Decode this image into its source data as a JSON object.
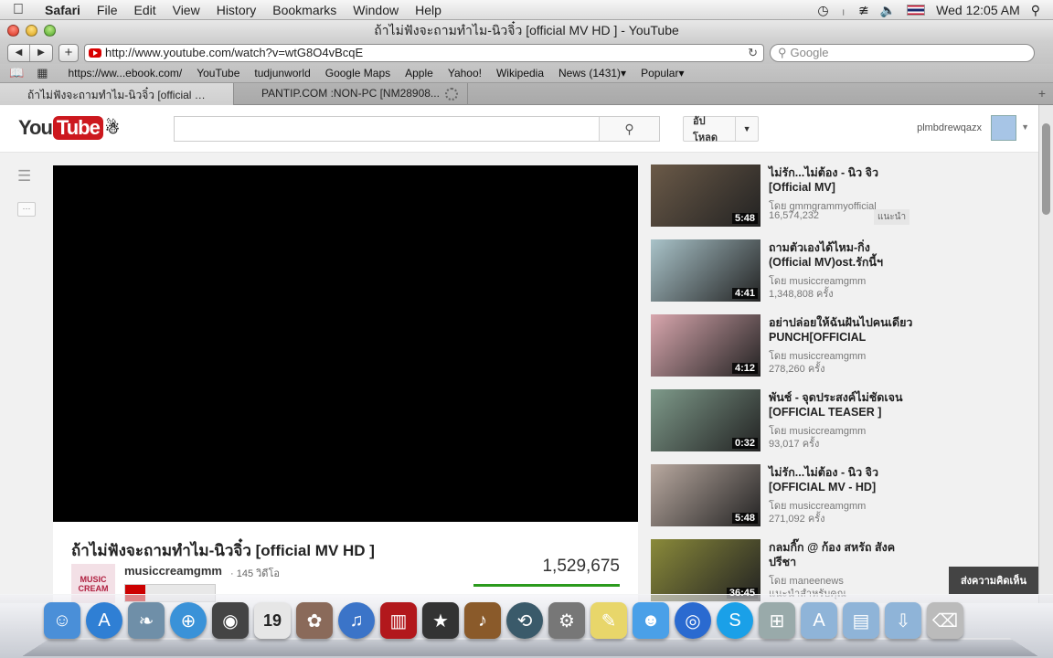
{
  "menubar": {
    "app": "Safari",
    "items": [
      "File",
      "Edit",
      "View",
      "History",
      "Bookmarks",
      "Window",
      "Help"
    ],
    "clock": "Wed 12:05 AM"
  },
  "window": {
    "title": "ถ้าไม่ฟังจะถามทำไม-นิวจิ๋ว [official MV HD ] - YouTube"
  },
  "toolbar": {
    "url": "http://www.youtube.com/watch?v=wtG8O4vBcqE",
    "search_placeholder": "Google"
  },
  "bookmarks": [
    "https://ww...ebook.com/",
    "YouTube",
    "tudjunworld",
    "Google Maps",
    "Apple",
    "Yahoo!",
    "Wikipedia",
    "News (1431)",
    "Popular"
  ],
  "tabs": [
    {
      "label": "ถ้าไม่ฟังจะถามทำไม-นิวจิ๋ว [official MV..."
    },
    {
      "label": "PANTIP.COM :NON-PC [NM28908..."
    }
  ],
  "youtube": {
    "logo_you": "You",
    "logo_tube": "Tube",
    "upload_label": "อัปโหลด",
    "username": "plmbdrewqazx",
    "video_title": "ถ้าไม่ฟังจะถามทำไม-นิวจิ๋ว [official MV HD ]",
    "channel_name": "musiccreamgmm",
    "channel_thumb": "MUSIC CREAM",
    "channel_video_count": "· 145 วิดีโอ",
    "view_count": "1,529,675",
    "feedback": "ส่งความคิดเห็น"
  },
  "related": [
    {
      "title": "ไม่รัก...ไม่ต้อง - นิว จิว [Official MV]",
      "by": "โดย gmmgrammyofficial",
      "views": "16,574,232",
      "duration": "5:48",
      "badge": "แนะนำ",
      "color": "#6b5a48"
    },
    {
      "title": "ถามตัวเองได้ไหม-กิ่ง (Official MV)ost.รักนี้ฯ",
      "by": "โดย musiccreamgmm",
      "views": "1,348,808 ครั้ง",
      "duration": "4:41",
      "badge": "",
      "color": "#a9c3c9"
    },
    {
      "title": "อย่าปล่อยให้ฉันฝันไปคนเดียว PUNCH[OFFICIAL",
      "by": "โดย musiccreamgmm",
      "views": "278,260 ครั้ง",
      "duration": "4:12",
      "badge": "",
      "color": "#d8a6ad"
    },
    {
      "title": "พันช์ - จุดประสงค์ไม่ชัดเจน [OFFICIAL TEASER ]",
      "by": "โดย musiccreamgmm",
      "views": "93,017 ครั้ง",
      "duration": "0:32",
      "badge": "",
      "color": "#7e9a8a"
    },
    {
      "title": "ไม่รัก...ไม่ต้อง - นิว จิว [OFFICIAL MV - HD]",
      "by": "โดย musiccreamgmm",
      "views": "271,092 ครั้ง",
      "duration": "5:48",
      "badge": "",
      "color": "#b9a9a0"
    },
    {
      "title": "กลมกิ๊ก @ ก้อง สหรัถ สังคปรีชา",
      "by": "โดย maneenews",
      "views": "แนะนำสำหรับคุณ",
      "duration": "36:45",
      "badge": "",
      "color": "#8a8a3a"
    }
  ],
  "dock": [
    {
      "icon": "finder-icon",
      "color": "#4a8fd8"
    },
    {
      "icon": "app-store-icon",
      "color": "#2f7fd4"
    },
    {
      "icon": "preview-icon",
      "color": "#6f8fa8"
    },
    {
      "icon": "safari-icon",
      "color": "#3a92d8"
    },
    {
      "icon": "facetime-icon",
      "color": "#444"
    },
    {
      "icon": "calendar-icon",
      "color": "#e6e6e6"
    },
    {
      "icon": "photo-booth-icon",
      "color": "#8a6a5a"
    },
    {
      "icon": "itunes-icon",
      "color": "#3b74c8"
    },
    {
      "icon": "photo-booth-red-icon",
      "color": "#b2181c"
    },
    {
      "icon": "imovie-icon",
      "color": "#333"
    },
    {
      "icon": "garageband-icon",
      "color": "#8a5a2a"
    },
    {
      "icon": "time-machine-icon",
      "color": "#3a5a6a"
    },
    {
      "icon": "system-preferences-icon",
      "color": "#777"
    },
    {
      "icon": "stickies-icon",
      "color": "#e8d66a"
    },
    {
      "icon": "messenger-icon",
      "color": "#4aa0e8"
    },
    {
      "icon": "dvd-player-icon",
      "color": "#2a6ad0"
    },
    {
      "icon": "skype-icon",
      "color": "#1aa0e8"
    },
    {
      "icon": "windows-icon",
      "color": "#9aa"
    },
    {
      "icon": "applications-folder-icon",
      "color": "#8fb4d8"
    },
    {
      "icon": "documents-folder-icon",
      "color": "#8fb4d8"
    },
    {
      "icon": "downloads-folder-icon",
      "color": "#8fb4d8"
    },
    {
      "icon": "trash-icon",
      "color": "#bbb"
    }
  ],
  "dock_calendar_day": "19"
}
